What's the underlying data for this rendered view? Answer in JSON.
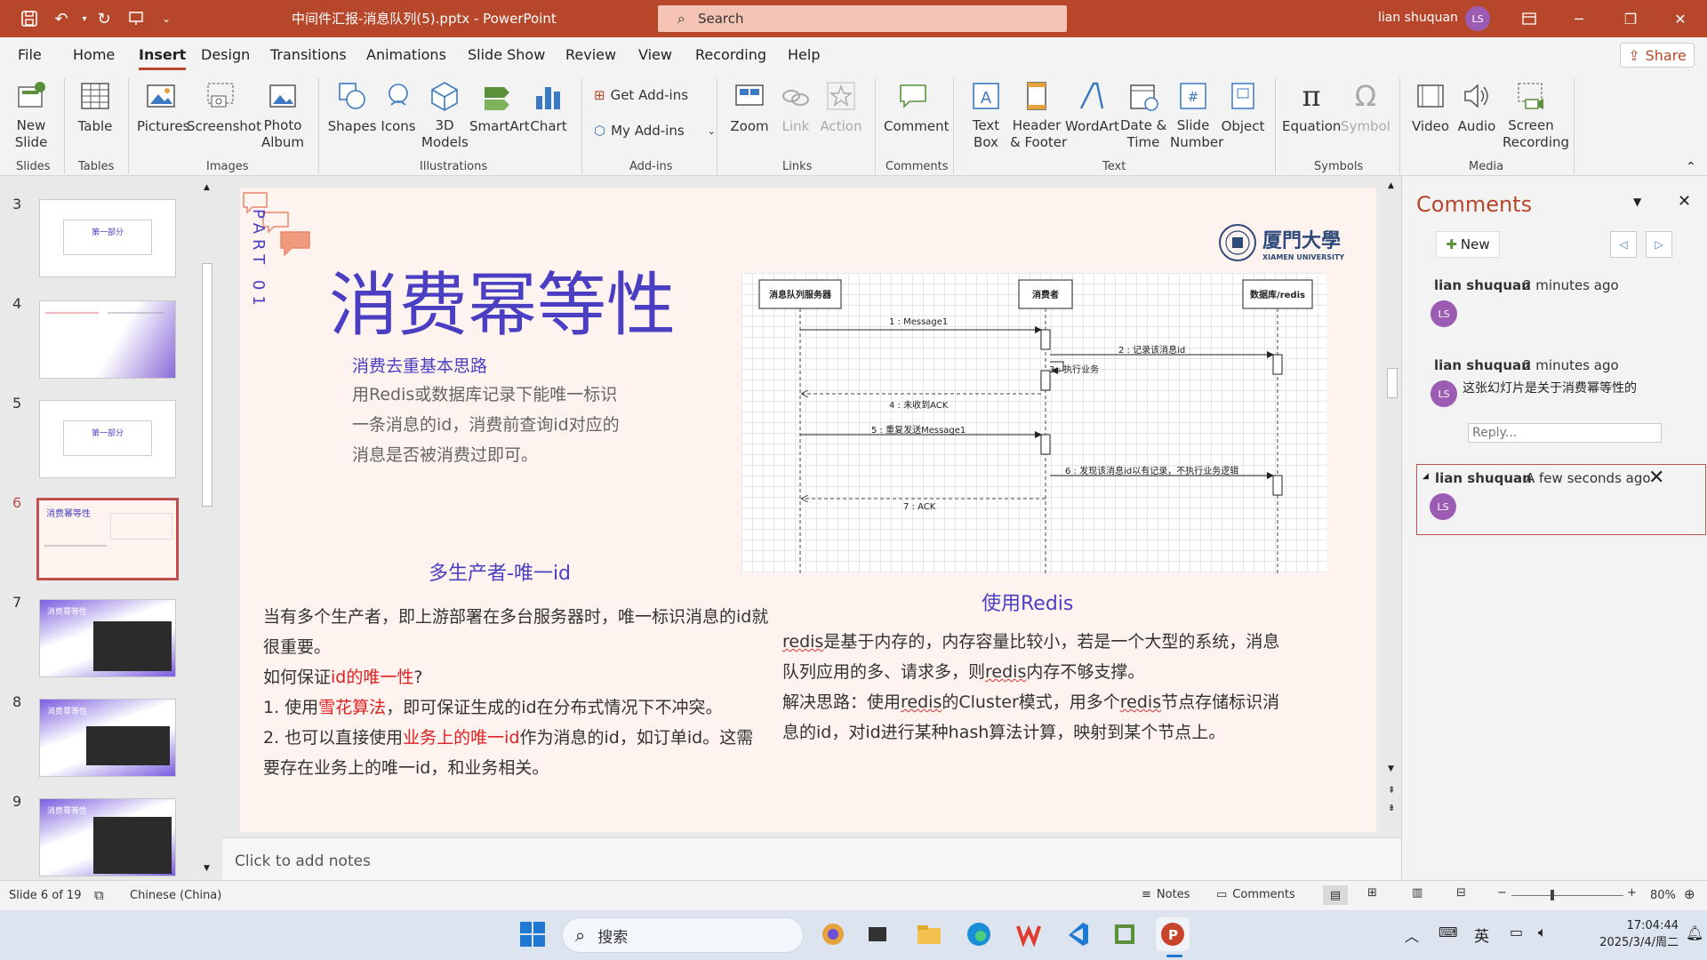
{
  "titlebar": {
    "doc_title": "中间件汇报-消息队列(5).pptx  -  PowerPoint",
    "search_placeholder": "Search",
    "user": "lian shuquan",
    "avatar_initials": "LS"
  },
  "menu": {
    "items": [
      "File",
      "Home",
      "Insert",
      "Design",
      "Transitions",
      "Animations",
      "Slide Show",
      "Review",
      "View",
      "Recording",
      "Help"
    ],
    "active": "Insert",
    "share": "Share"
  },
  "ribbon": {
    "new_slide": "New\nSlide",
    "table": "Table",
    "pictures": "Pictures",
    "screenshot": "Screenshot",
    "photo_album": "Photo\nAlbum",
    "shapes": "Shapes",
    "icons": "Icons",
    "models": "3D\nModels",
    "smartart": "SmartArt",
    "chart": "Chart",
    "get_addins": "Get Add-ins",
    "my_addins": "My Add-ins",
    "zoom": "Zoom",
    "link": "Link",
    "action": "Action",
    "comment": "Comment",
    "text_box": "Text\nBox",
    "header_footer": "Header\n& Footer",
    "wordart": "WordArt",
    "date_time": "Date &\nTime",
    "slide_number": "Slide\nNumber",
    "object": "Object",
    "equation": "Equation",
    "symbol": "Symbol",
    "video": "Video",
    "audio": "Audio",
    "screen_recording": "Screen\nRecording",
    "groups": {
      "slides": "Slides",
      "tables": "Tables",
      "images": "Images",
      "illustrations": "Illustrations",
      "addins": "Add-ins",
      "links": "Links",
      "comments": "Comments",
      "text": "Text",
      "symbols": "Symbols",
      "media": "Media"
    }
  },
  "thumbnails": {
    "numbers": [
      "3",
      "4",
      "5",
      "6",
      "7",
      "8",
      "9"
    ],
    "selected": "6",
    "t3_title": "第一部分",
    "t5_title": "第一部分",
    "t6_title": "消费幂等性",
    "t7_title": "消费幂等性",
    "t8_title": "消费幂等性",
    "t9_title": "消费幂等性"
  },
  "slide": {
    "part_label": "PART 01",
    "title": "消费幂等性",
    "logo_text": "厦門大學",
    "logo_sub": "XIAMEN UNIVERSITY",
    "section1_heading": "消费去重基本思路",
    "section1_body": "用Redis或数据库记录下能唯一标识一条消息的id，消费前查询id对应的消息是否被消费过即可。",
    "section2_heading": "多生产者-唯一id",
    "section2_line1": "当有多个生产者，即上游部署在多台服务器时，唯一标识消息的id就很重要。",
    "section2_line2a": "如何保证",
    "section2_line2b": "id的唯一性",
    "section2_line2c": "?",
    "section2_line3a": "1. 使用",
    "section2_line3b": "雪花算法",
    "section2_line3c": "，即可保证生成的id在分布式情况下不冲突。",
    "section2_line4a": "2. 也可以直接使用",
    "section2_line4b": "业务上的唯一id",
    "section2_line4c": "作为消息的id，如订单id。这需要存在业务上的唯一id，和业务相关。",
    "section3_heading": "使用Redis",
    "section3_p1a": "redis",
    "section3_p1b": "是基于内存的，内存容量比较小，若是一个大型的系统，消息队列应用的多、请求多，则",
    "section3_p1c": "redis",
    "section3_p1d": "内存不够支撑。",
    "section3_p2a": "解决思路：使用",
    "section3_p2b": "redis",
    "section3_p2c": "的Cluster模式，用多个",
    "section3_p2d": "redis",
    "section3_p2e": "节点存储标识消息的id，对id进行某种hash算法计算，映射到某个节点上。",
    "diagram": {
      "actors": [
        "消息队列服务器",
        "消费者",
        "数据库/redis"
      ],
      "messages": [
        "1 : Message1",
        "2 : 记录该消息id",
        "3 : 执行业务",
        "4 : 未收到ACK",
        "5 : 重复发送Message1",
        "6 : 发现该消息id以有记录，不执行业务逻辑",
        "7 : ACK"
      ]
    }
  },
  "notes_placeholder": "Click to add notes",
  "comments": {
    "header": "Comments",
    "new_button": "New",
    "c1_author": "lian shuquan",
    "c1_time": "2 minutes ago",
    "c2_author": "lian shuquan",
    "c2_time": "2 minutes ago",
    "c2_text": "这张幻灯片是关于消费幂等性的",
    "reply_placeholder": "Reply...",
    "c3_author": "lian shuquan",
    "c3_time": "A few seconds ago",
    "initials": "LS"
  },
  "status": {
    "slide_info": "Slide 6 of 19",
    "language": "Chinese (China)",
    "notes": "Notes",
    "comments": "Comments",
    "zoom": "80%"
  },
  "taskbar": {
    "search_placeholder": "搜索",
    "ime": "英",
    "time": "17:04:44",
    "date": "2025/3/4/周二"
  },
  "colors": {
    "brand": "#b7472a",
    "slide_heading": "#4a3fc2",
    "highlight": "#e02020"
  }
}
